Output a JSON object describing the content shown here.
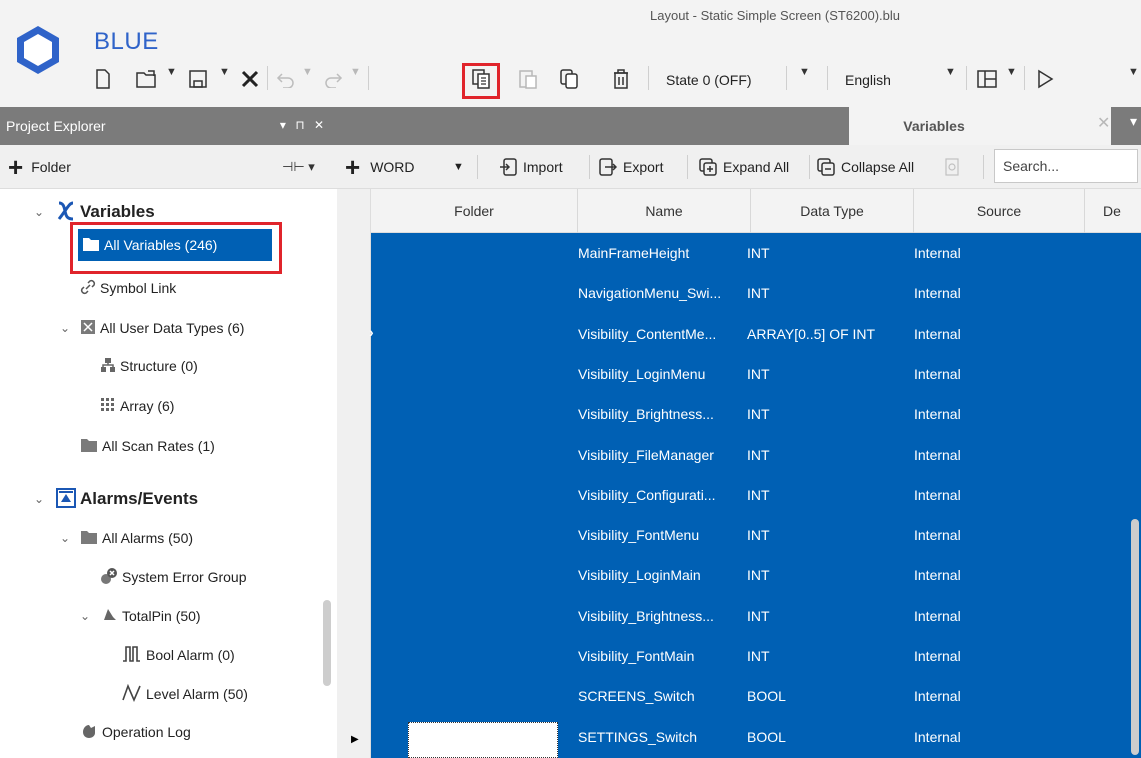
{
  "app": {
    "name": "BLUE",
    "window_title": "Layout - Static Simple Screen (ST6200).blu",
    "brand_color": "#2f63c9"
  },
  "toolbar": {
    "state_combo": "State 0 (OFF)",
    "language_combo": "English",
    "highlight_color": "#e0242b"
  },
  "project_explorer": {
    "title": "Project Explorer",
    "folder_button": "Folder",
    "tree": {
      "variables": "Variables",
      "all_variables": "All Variables (246)",
      "symbol_link": "Symbol Link",
      "all_user_data_types": "All User Data Types (6)",
      "structure": "Structure (0)",
      "array": "Array (6)",
      "all_scan_rates": "All Scan Rates (1)",
      "alarms_events": "Alarms/Events",
      "all_alarms": "All Alarms (50)",
      "system_error_group": "System Error Group",
      "totalpin": "TotalPin (50)",
      "bool_alarm": "Bool Alarm (0)",
      "level_alarm": "Level Alarm (50)",
      "operation_log": "Operation Log"
    }
  },
  "variables_tab": {
    "title": "Variables",
    "toolbar": {
      "add_type": "WORD",
      "import": "Import",
      "export": "Export",
      "expand_all": "Expand All",
      "collapse_all": "Collapse All",
      "search_placeholder": "Search..."
    },
    "columns": [
      "Folder",
      "Name",
      "Data Type",
      "Source",
      "De"
    ],
    "rows": [
      {
        "name": "MainFrameHeight",
        "type": "INT",
        "source": "Internal"
      },
      {
        "name": "NavigationMenu_Swi...",
        "type": "INT",
        "source": "Internal"
      },
      {
        "name": "Visibility_ContentMe...",
        "type": "ARRAY[0..5] OF INT",
        "source": "Internal"
      },
      {
        "name": "Visibility_LoginMenu",
        "type": "INT",
        "source": "Internal"
      },
      {
        "name": "Visibility_Brightness...",
        "type": "INT",
        "source": "Internal"
      },
      {
        "name": "Visibility_FileManager",
        "type": "INT",
        "source": "Internal"
      },
      {
        "name": "Visibility_Configurati...",
        "type": "INT",
        "source": "Internal"
      },
      {
        "name": "Visibility_FontMenu",
        "type": "INT",
        "source": "Internal"
      },
      {
        "name": "Visibility_LoginMain",
        "type": "INT",
        "source": "Internal"
      },
      {
        "name": "Visibility_Brightness...",
        "type": "INT",
        "source": "Internal"
      },
      {
        "name": "Visibility_FontMain",
        "type": "INT",
        "source": "Internal"
      },
      {
        "name": "SCREENS_Switch",
        "type": "BOOL",
        "source": "Internal"
      },
      {
        "name": "SETTINGS_Switch",
        "type": "BOOL",
        "source": "Internal"
      }
    ],
    "selection_color": "#0060b4"
  }
}
